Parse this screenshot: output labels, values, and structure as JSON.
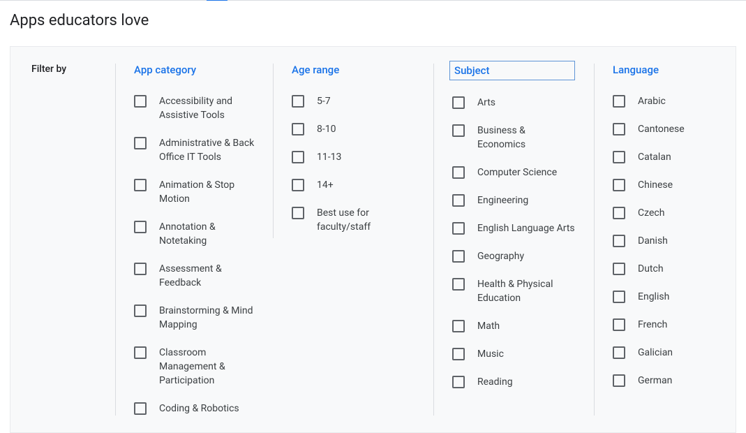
{
  "page": {
    "title": "Apps educators love",
    "filter_by_label": "Filter by"
  },
  "filters": {
    "app_category": {
      "header": "App category",
      "options": [
        "Accessibility and Assistive Tools",
        "Administrative & Back Office IT Tools",
        "Animation & Stop Motion",
        "Annotation & Notetaking",
        "Assessment & Feedback",
        "Brainstorming & Mind Mapping",
        "Classroom Management & Participation",
        "Coding & Robotics"
      ]
    },
    "age_range": {
      "header": "Age range",
      "options": [
        "5-7",
        "8-10",
        "11-13",
        "14+",
        "Best use for faculty/staff"
      ]
    },
    "subject": {
      "header": "Subject",
      "options": [
        "Arts",
        "Business & Economics",
        "Computer Science",
        "Engineering",
        "English Language Arts",
        "Geography",
        "Health & Physical Education",
        "Math",
        "Music",
        "Reading"
      ]
    },
    "language": {
      "header": "Language",
      "options": [
        "Arabic",
        "Cantonese",
        "Catalan",
        "Chinese",
        "Czech",
        "Danish",
        "Dutch",
        "English",
        "French",
        "Galician",
        "German"
      ]
    }
  }
}
